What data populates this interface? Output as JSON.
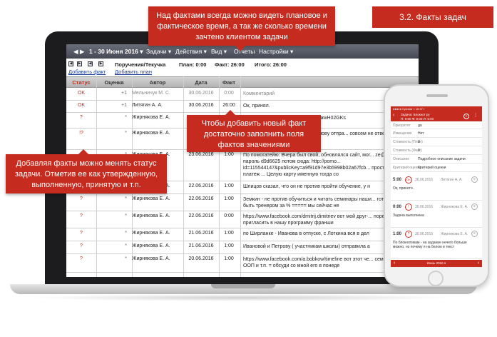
{
  "slide": {
    "title": "3.2. Факты задач"
  },
  "callouts": {
    "top": "Над фактами всегда можно видеть плановое и фактическое время, а так же сколько времени зачтено клиентом задачи",
    "middle": "Чтобы добавить новый факт достаточно заполнить поля фактов значениями",
    "left": "Добавляя факты можно менять статус задачи. Отметив ее как утвержденную, выполненную, принятую и т.п."
  },
  "app": {
    "menubar": {
      "nav_arrows": "◀ ▶",
      "date_range": "1 - 30 Июня 2016 ▾",
      "menu": [
        "Задачи ▾",
        "Действия ▾",
        "Вид ▾",
        "Отчеты",
        "Настройки ▾"
      ]
    },
    "toolbar": {
      "pager": [
        "◀",
        "▶",
        "◀",
        "▶"
      ],
      "add_fact": "Добавить факт",
      "add_plan": "Добавить план",
      "context": "Поручения/Текучка",
      "plan": "План: 0:00",
      "fact": "Факт: 26:00",
      "total": "Итого: 26:00"
    },
    "columns": [
      "Статус",
      "Оценка",
      "Автор",
      "Дата",
      "Факт",
      ""
    ],
    "rows": [
      {
        "status": "OK",
        "mark": "+1",
        "author": "Мельничук М. С.",
        "date": "30.06.2016",
        "fact": "0:00",
        "comment": "Комментарий"
      },
      {
        "status": "OK",
        "mark": "+1",
        "author": "Литягин А. А.",
        "date": "30.06.2016",
        "fact": "26:00",
        "comment": "Ок, принял."
      },
      {
        "status": "?",
        "mark": "*",
        "author": "Жирнякова Е. А.",
        "date": "",
        "fact": "",
        "comment": "...блички - давайте вы ...us/d/1XGawH02GKs"
      },
      {
        "status": "!?",
        "mark": "*",
        "author": "Жирнякова Е. А.",
        "date": "",
        "fact": "",
        "comment": "...сегодня отправляю ...ицу - Ивановy отпра... совсем не отвечает, а у Чернышовой, директору, по ол"
      },
      {
        "status": "?",
        "mark": "*",
        "author": "Жирнякова Е. А.",
        "date": "23.06.2016",
        "fact": "1:00",
        "comment": "По помогатейю: Вчера был свой, обновлялся сайт, мог... ze@2goal.biz пароль d9d6625 потом сюда: http://pomo... id=115544147&publicKey=a9f91d97e3b5998b02a67fcb... просто новый платеж ... Целую карту именную тогда со"
      },
      {
        "status": "?",
        "mark": "*",
        "author": "Жирнякова Е. А.",
        "date": "22.06.2016",
        "fact": "1:00",
        "comment": "Шлицов сказал, что он не против пройти обучение, у н"
      },
      {
        "status": "?",
        "mark": "*",
        "author": "Жирнякова Е. А.",
        "date": "22.06.2016",
        "fact": "1:00",
        "comment": "Земкин - не против обучиться и читать семинары наши... готов. Может быть тренером за % ===== мы сейчас не"
      },
      {
        "status": "?",
        "mark": "*",
        "author": "Жирнякова Е. А.",
        "date": "22.06.2016",
        "fact": "0:00",
        "comment": "https://www.facebook.com/dmitrij.dimitriev вот мой друг-... порекомендует пригласить в нашу программу франши"
      },
      {
        "status": "?",
        "mark": "*",
        "author": "Жирнякова Е. А.",
        "date": "21.06.2016",
        "fact": "1:00",
        "comment": "по Ширланке - Иванова в отпуске, с Лоткина вся в дел"
      },
      {
        "status": "?",
        "mark": "*",
        "author": "Жирнякова Е. А.",
        "date": "21.06.2016",
        "fact": "1:00",
        "comment": "Ивановой и Петрову ( участникам школы) отправила а"
      },
      {
        "status": "?",
        "mark": "*",
        "author": "Жирнякова Е. А.",
        "date": "20.06.2016",
        "fact": "1:00",
        "comment": "https://www.facebook.com/a.bobkow/timeline вот этот че... семинары по ООП и т.п. = обсуди со мной его в понеде"
      }
    ]
  },
  "phone": {
    "status": "●●●●● Kyivstar ≈   15:37   ▪",
    "header_title": "Задача: Блокнот ру",
    "header_sub": "П: 0:00  Ф: 5:00  И: 5:00",
    "fields": [
      {
        "label": "Приоритет",
        "value": "да"
      },
      {
        "label": "Извещения",
        "value": "Нет"
      },
      {
        "label": "Стоимость (План)",
        "value": "0"
      },
      {
        "label": "Стоимость (Факт)",
        "value": "0"
      },
      {
        "label": "Описание",
        "value": "Подробное описание задачи"
      },
      {
        "label": "Критерий оценки",
        "value": "Критерий оценки"
      }
    ],
    "facts": [
      {
        "time": "5:00",
        "badge": "OK",
        "date": "30.06.2016",
        "author": "Литягин А. А.",
        "text": "Ок, принято."
      },
      {
        "time": "0:00",
        "badge": "!",
        "date": "30.06.2016",
        "author": "Жирнякова Е. А.",
        "text": "Задача выполнена"
      },
      {
        "time": "1:00",
        "badge": "?",
        "date": "30.06.2016",
        "author": "Жирнякова Е. А.",
        "text": "По блокнотикам - на задание нечего больше можно, но почему я на белом и текст"
      }
    ],
    "footer": "Июнь 2016 ▾"
  },
  "colors": {
    "accent": "#c62b1f",
    "menubar": "#464955",
    "link": "#1a3c9a"
  }
}
